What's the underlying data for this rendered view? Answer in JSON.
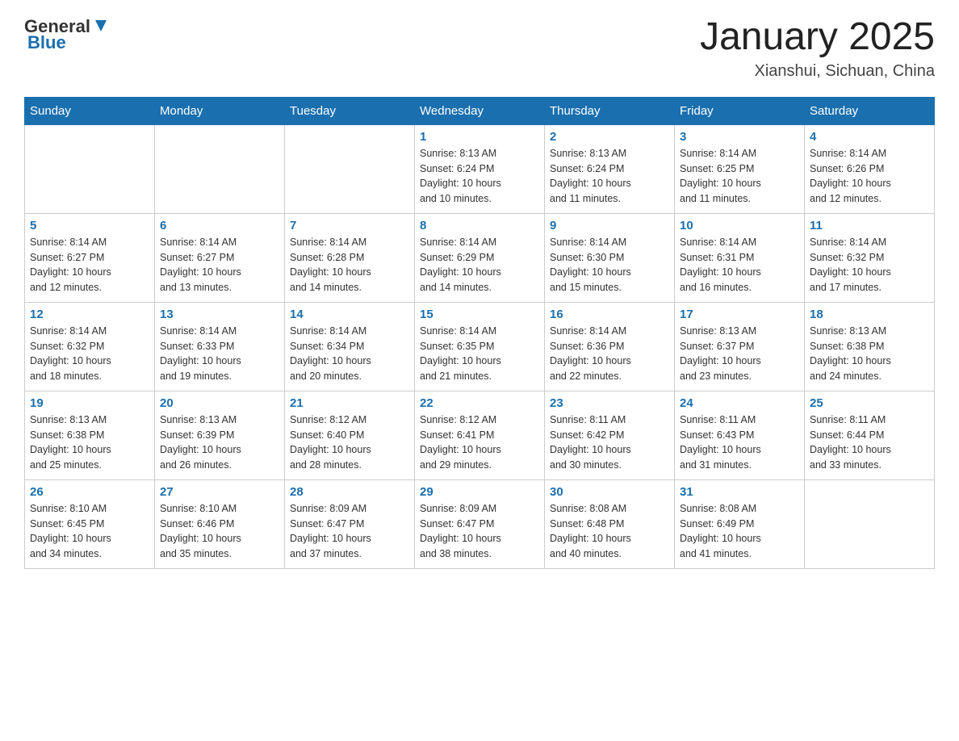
{
  "logo": {
    "general": "General",
    "blue": "Blue"
  },
  "header": {
    "title": "January 2025",
    "location": "Xianshui, Sichuan, China"
  },
  "days_of_week": [
    "Sunday",
    "Monday",
    "Tuesday",
    "Wednesday",
    "Thursday",
    "Friday",
    "Saturday"
  ],
  "weeks": [
    [
      {
        "day": "",
        "info": ""
      },
      {
        "day": "",
        "info": ""
      },
      {
        "day": "",
        "info": ""
      },
      {
        "day": "1",
        "info": "Sunrise: 8:13 AM\nSunset: 6:24 PM\nDaylight: 10 hours\nand 10 minutes."
      },
      {
        "day": "2",
        "info": "Sunrise: 8:13 AM\nSunset: 6:24 PM\nDaylight: 10 hours\nand 11 minutes."
      },
      {
        "day": "3",
        "info": "Sunrise: 8:14 AM\nSunset: 6:25 PM\nDaylight: 10 hours\nand 11 minutes."
      },
      {
        "day": "4",
        "info": "Sunrise: 8:14 AM\nSunset: 6:26 PM\nDaylight: 10 hours\nand 12 minutes."
      }
    ],
    [
      {
        "day": "5",
        "info": "Sunrise: 8:14 AM\nSunset: 6:27 PM\nDaylight: 10 hours\nand 12 minutes."
      },
      {
        "day": "6",
        "info": "Sunrise: 8:14 AM\nSunset: 6:27 PM\nDaylight: 10 hours\nand 13 minutes."
      },
      {
        "day": "7",
        "info": "Sunrise: 8:14 AM\nSunset: 6:28 PM\nDaylight: 10 hours\nand 14 minutes."
      },
      {
        "day": "8",
        "info": "Sunrise: 8:14 AM\nSunset: 6:29 PM\nDaylight: 10 hours\nand 14 minutes."
      },
      {
        "day": "9",
        "info": "Sunrise: 8:14 AM\nSunset: 6:30 PM\nDaylight: 10 hours\nand 15 minutes."
      },
      {
        "day": "10",
        "info": "Sunrise: 8:14 AM\nSunset: 6:31 PM\nDaylight: 10 hours\nand 16 minutes."
      },
      {
        "day": "11",
        "info": "Sunrise: 8:14 AM\nSunset: 6:32 PM\nDaylight: 10 hours\nand 17 minutes."
      }
    ],
    [
      {
        "day": "12",
        "info": "Sunrise: 8:14 AM\nSunset: 6:32 PM\nDaylight: 10 hours\nand 18 minutes."
      },
      {
        "day": "13",
        "info": "Sunrise: 8:14 AM\nSunset: 6:33 PM\nDaylight: 10 hours\nand 19 minutes."
      },
      {
        "day": "14",
        "info": "Sunrise: 8:14 AM\nSunset: 6:34 PM\nDaylight: 10 hours\nand 20 minutes."
      },
      {
        "day": "15",
        "info": "Sunrise: 8:14 AM\nSunset: 6:35 PM\nDaylight: 10 hours\nand 21 minutes."
      },
      {
        "day": "16",
        "info": "Sunrise: 8:14 AM\nSunset: 6:36 PM\nDaylight: 10 hours\nand 22 minutes."
      },
      {
        "day": "17",
        "info": "Sunrise: 8:13 AM\nSunset: 6:37 PM\nDaylight: 10 hours\nand 23 minutes."
      },
      {
        "day": "18",
        "info": "Sunrise: 8:13 AM\nSunset: 6:38 PM\nDaylight: 10 hours\nand 24 minutes."
      }
    ],
    [
      {
        "day": "19",
        "info": "Sunrise: 8:13 AM\nSunset: 6:38 PM\nDaylight: 10 hours\nand 25 minutes."
      },
      {
        "day": "20",
        "info": "Sunrise: 8:13 AM\nSunset: 6:39 PM\nDaylight: 10 hours\nand 26 minutes."
      },
      {
        "day": "21",
        "info": "Sunrise: 8:12 AM\nSunset: 6:40 PM\nDaylight: 10 hours\nand 28 minutes."
      },
      {
        "day": "22",
        "info": "Sunrise: 8:12 AM\nSunset: 6:41 PM\nDaylight: 10 hours\nand 29 minutes."
      },
      {
        "day": "23",
        "info": "Sunrise: 8:11 AM\nSunset: 6:42 PM\nDaylight: 10 hours\nand 30 minutes."
      },
      {
        "day": "24",
        "info": "Sunrise: 8:11 AM\nSunset: 6:43 PM\nDaylight: 10 hours\nand 31 minutes."
      },
      {
        "day": "25",
        "info": "Sunrise: 8:11 AM\nSunset: 6:44 PM\nDaylight: 10 hours\nand 33 minutes."
      }
    ],
    [
      {
        "day": "26",
        "info": "Sunrise: 8:10 AM\nSunset: 6:45 PM\nDaylight: 10 hours\nand 34 minutes."
      },
      {
        "day": "27",
        "info": "Sunrise: 8:10 AM\nSunset: 6:46 PM\nDaylight: 10 hours\nand 35 minutes."
      },
      {
        "day": "28",
        "info": "Sunrise: 8:09 AM\nSunset: 6:47 PM\nDaylight: 10 hours\nand 37 minutes."
      },
      {
        "day": "29",
        "info": "Sunrise: 8:09 AM\nSunset: 6:47 PM\nDaylight: 10 hours\nand 38 minutes."
      },
      {
        "day": "30",
        "info": "Sunrise: 8:08 AM\nSunset: 6:48 PM\nDaylight: 10 hours\nand 40 minutes."
      },
      {
        "day": "31",
        "info": "Sunrise: 8:08 AM\nSunset: 6:49 PM\nDaylight: 10 hours\nand 41 minutes."
      },
      {
        "day": "",
        "info": ""
      }
    ]
  ]
}
